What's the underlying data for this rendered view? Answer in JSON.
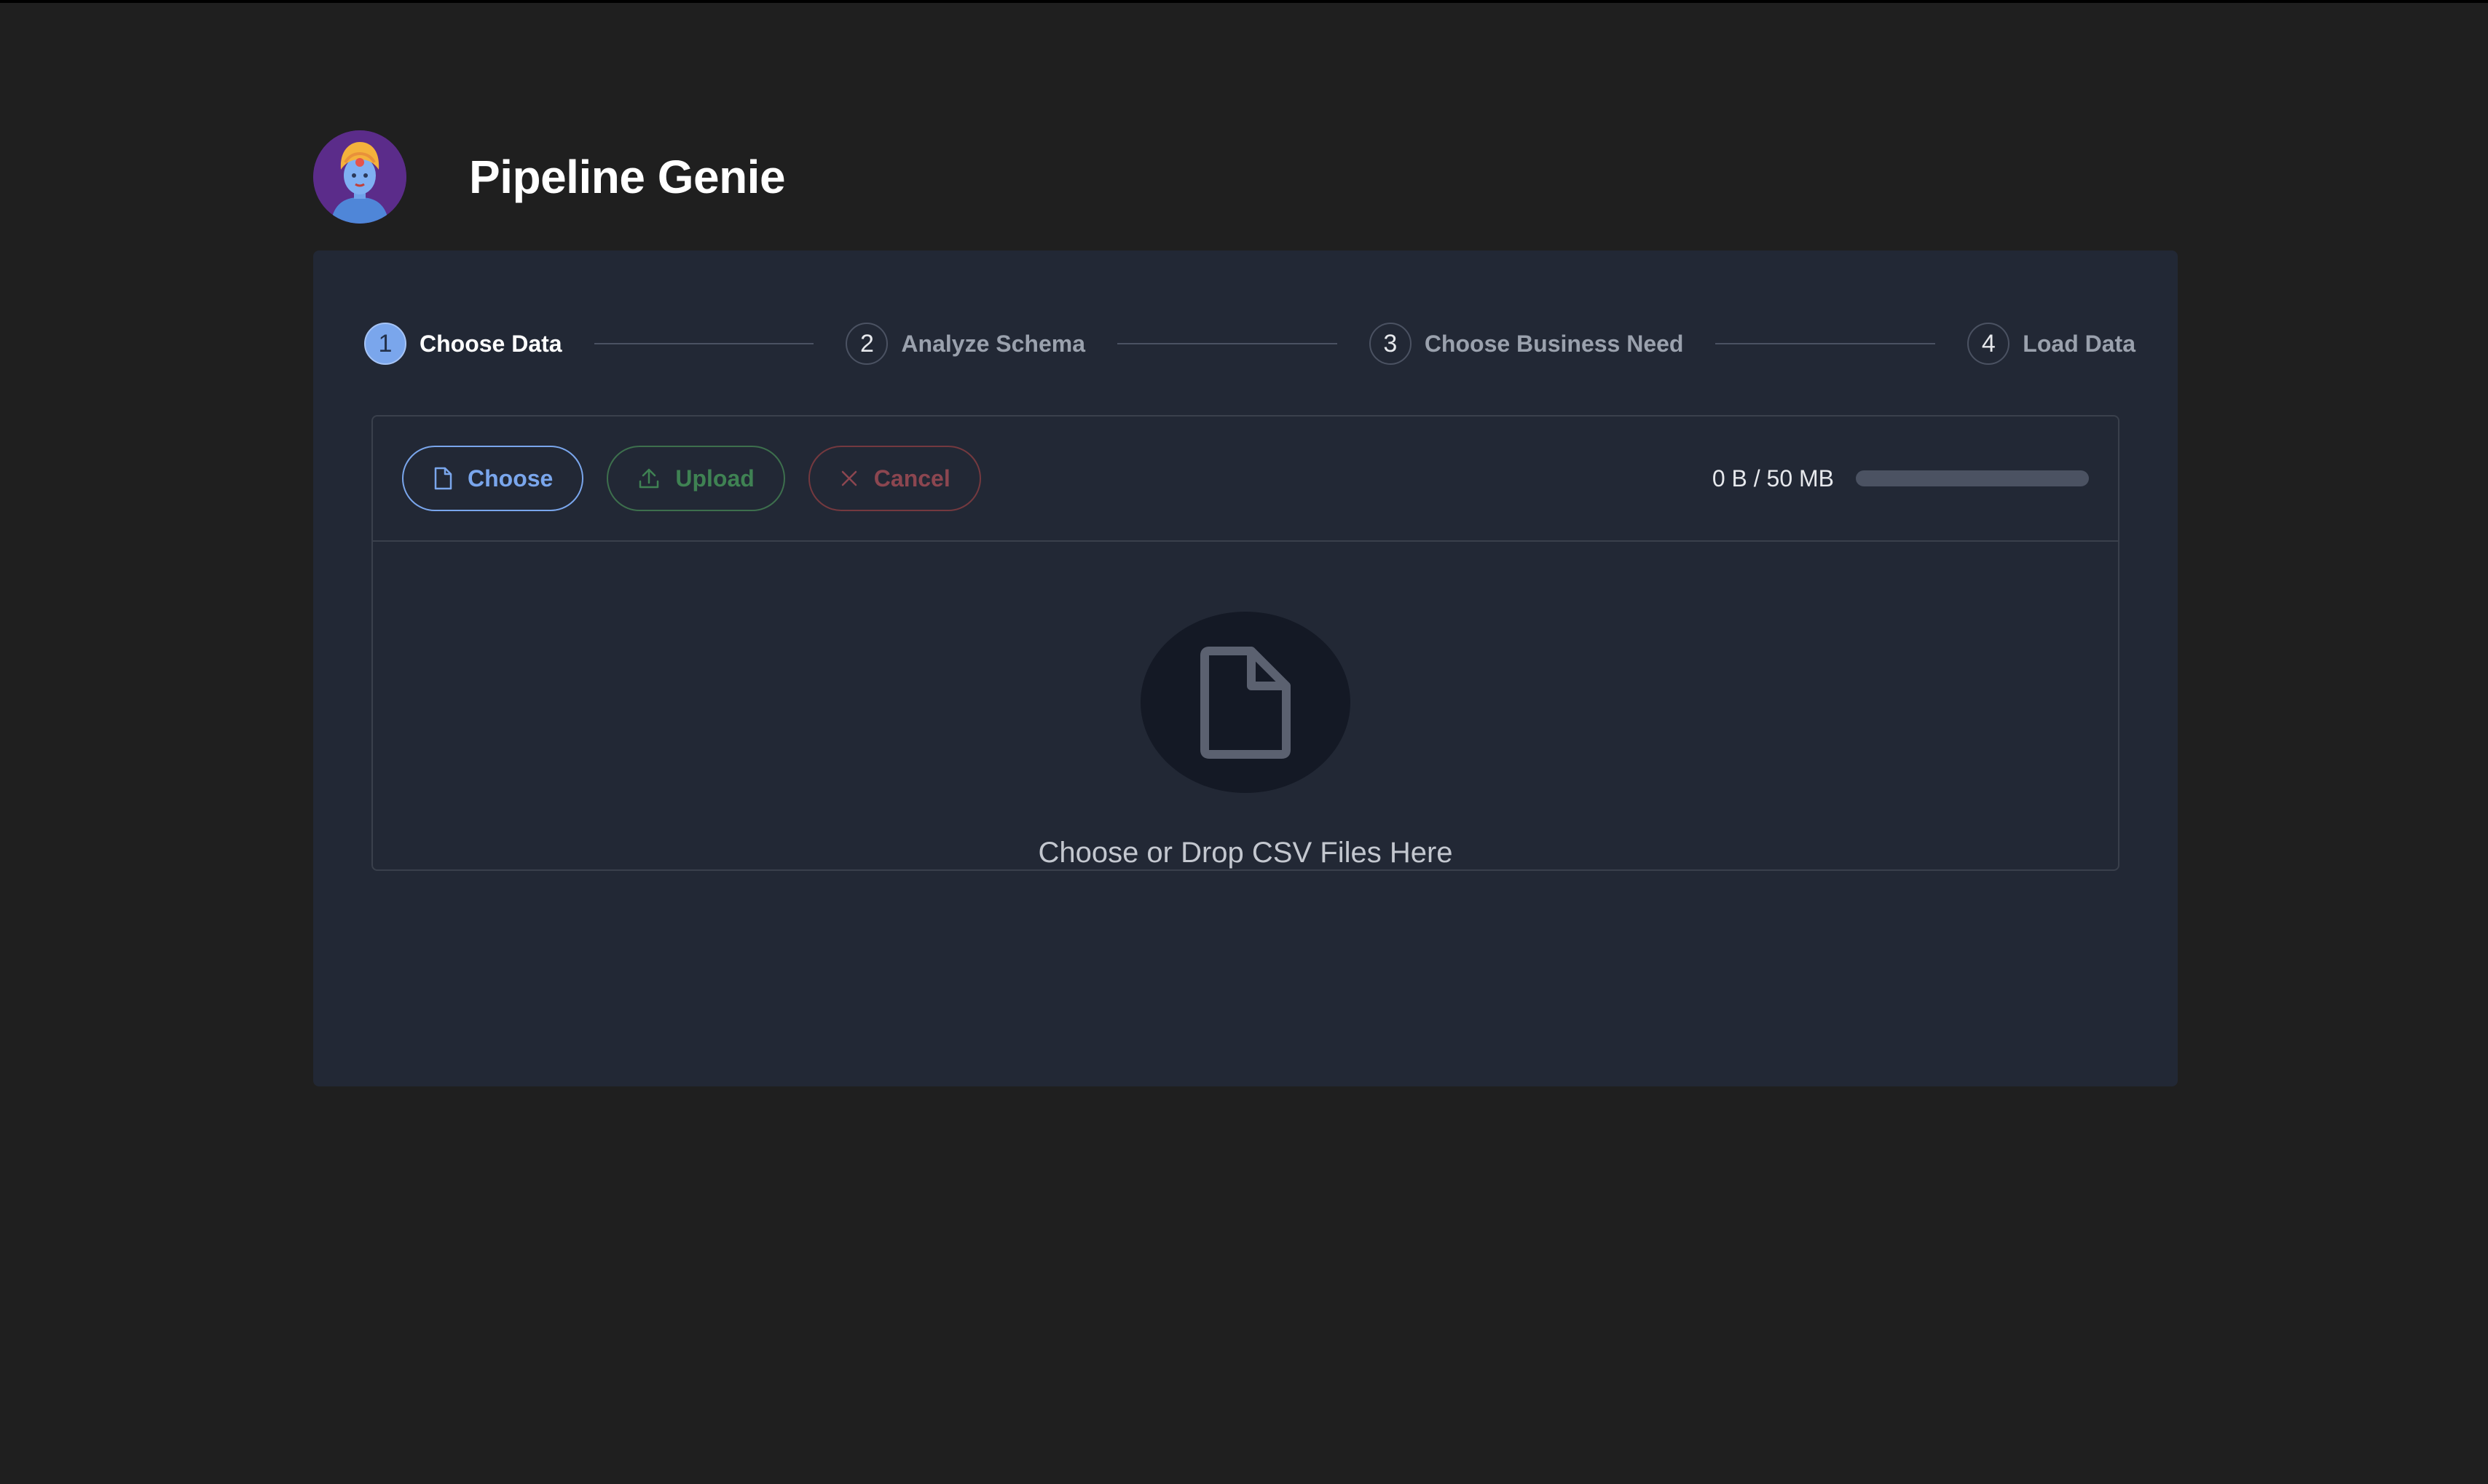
{
  "app": {
    "title": "Pipeline Genie",
    "logo_icon": "genie-avatar-icon"
  },
  "stepper": {
    "steps": [
      {
        "number": "1",
        "label": "Choose Data",
        "active": true
      },
      {
        "number": "2",
        "label": "Analyze Schema",
        "active": false
      },
      {
        "number": "3",
        "label": "Choose Business Need",
        "active": false
      },
      {
        "number": "4",
        "label": "Load Data",
        "active": false
      }
    ]
  },
  "uploader": {
    "choose_label": "Choose",
    "upload_label": "Upload",
    "cancel_label": "Cancel",
    "size_text": "0 B / 50 MB",
    "progress_fraction": 0,
    "empty_text": "Choose or Drop CSV Files Here",
    "empty_icon": "file-icon"
  },
  "colors": {
    "accent": "#7aa6ec",
    "upload": "#3f8253",
    "cancel": "#8c4650",
    "background": "#1f1f1f",
    "card": "#222835"
  }
}
